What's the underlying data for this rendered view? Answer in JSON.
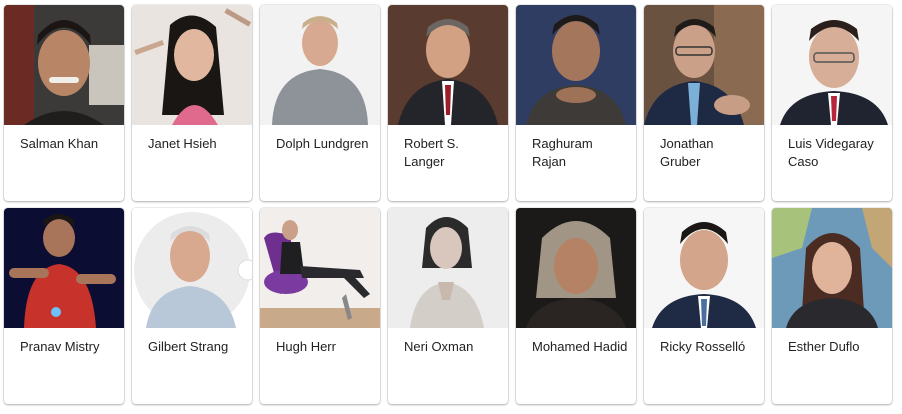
{
  "people": [
    {
      "name": "Salman Khan"
    },
    {
      "name": "Janet Hsieh"
    },
    {
      "name": "Dolph Lundgren"
    },
    {
      "name": "Robert S. Langer"
    },
    {
      "name": "Raghuram Rajan"
    },
    {
      "name": "Jonathan Gruber"
    },
    {
      "name": "Luis Videgaray Caso"
    },
    {
      "name": "Pranav Mistry"
    },
    {
      "name": "Gilbert Strang"
    },
    {
      "name": "Hugh Herr"
    },
    {
      "name": "Neri Oxman"
    },
    {
      "name": "Mohamed Hadid"
    },
    {
      "name": "Ricky Rosselló"
    },
    {
      "name": "Esther Duflo"
    }
  ]
}
